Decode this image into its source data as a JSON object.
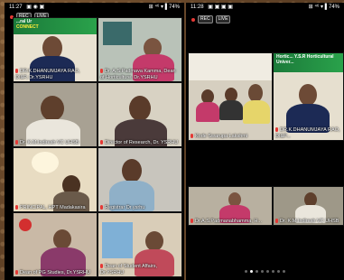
{
  "left_phone": {
    "status": {
      "time": "11:27",
      "icons": "▣ ◉ ▣",
      "right": "⊞ ⁴⁶ ▾ ▌74%"
    },
    "tiles": [
      {
        "name": "DR.K.DHANUMJAYA RAO, DI&P, Dr.YSRHU",
        "banner_title": "...ral Ur",
        "banner_sub": "CONNECT",
        "mic_muted": true
      },
      {
        "name": "Dr. A.S.Padmava Kamma, Dean of Horticulture, Dr.YSRHU",
        "mic_muted": true
      },
      {
        "name": "Dr. K.M.Indiresh VC UHSB",
        "mic_muted": true
      },
      {
        "name": "Director of Research, Dr. YSRHU",
        "mic_muted": true
      },
      {
        "name": "PRINCIPAL, HPT Madakasira",
        "mic_muted": true
      },
      {
        "name": "Registrar Dr.ysrhu",
        "mic_muted": true
      },
      {
        "name": "Dean of PG Studies, Dr.YSRHU",
        "mic_muted": true
      },
      {
        "name": "Dean of Student Affairs, Dr.YSRHU",
        "mic_muted": true
      }
    ]
  },
  "right_phone": {
    "status": {
      "time": "11:28",
      "icons": "▣ ▣ ▣ ▣",
      "right": "⊞ ⁴⁶ ▾ ▌74%"
    },
    "rec_label": "REC",
    "live_label": "LIVE",
    "banner_title": "Hortic... Y.S.R Horticultural Univer...",
    "tiles": [
      {
        "name": "Kode Swarupa Lakshmi",
        "mic_muted": true
      },
      {
        "name": "DR.K.DHANUMJAYA RAO, DI&P...",
        "mic_muted": true
      },
      {
        "name": "Dr.A.S.Padmanabhamma, H...",
        "mic_muted": true
      },
      {
        "name": "Dr. K.M.Indiresh VC UHSB",
        "mic_muted": true
      }
    ],
    "pages": 8,
    "current_page": 1
  },
  "left_rec_label": "REC",
  "left_live_label": "LIVE"
}
